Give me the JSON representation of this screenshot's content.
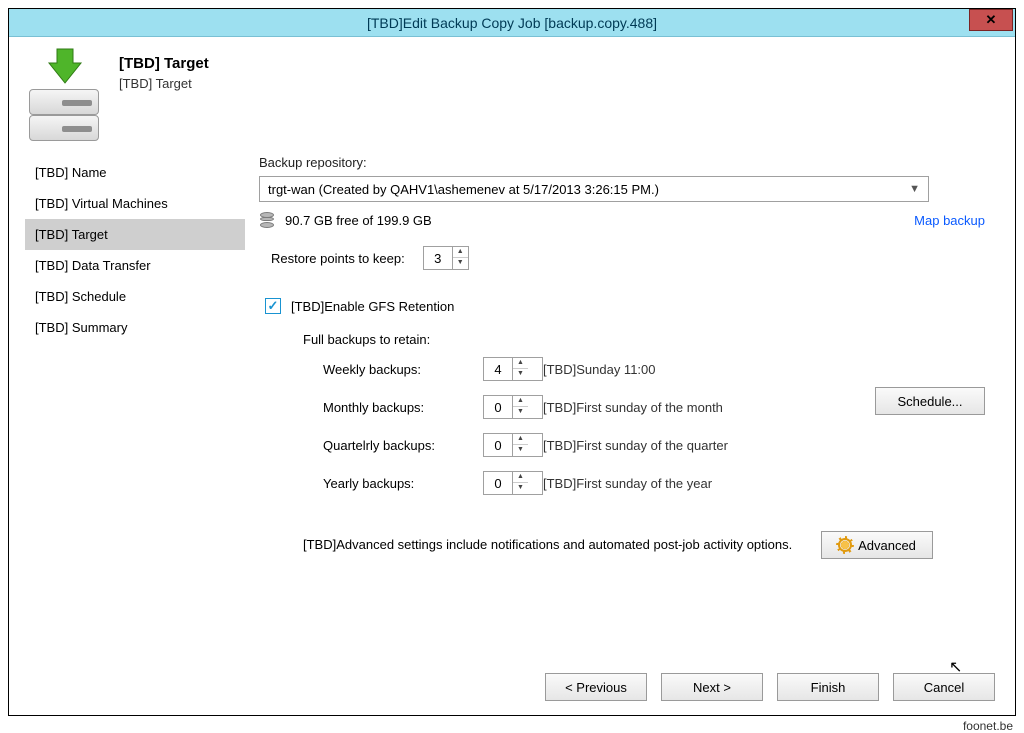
{
  "window": {
    "title": "[TBD]Edit Backup Copy Job [backup.copy.488]"
  },
  "header": {
    "title": "[TBD] Target",
    "subtitle": "[TBD] Target"
  },
  "sidebar": {
    "items": [
      {
        "label": "[TBD] Name"
      },
      {
        "label": "[TBD] Virtual Machines"
      },
      {
        "label": "[TBD] Target"
      },
      {
        "label": "[TBD] Data Transfer"
      },
      {
        "label": "[TBD] Schedule"
      },
      {
        "label": "[TBD] Summary"
      }
    ]
  },
  "content": {
    "repo_label": "Backup repository:",
    "repo_value": "trgt-wan (Created by QAHV1\\ashemenev at 5/17/2013 3:26:15 PM.)",
    "free_text": "90.7 GB free of 199.9 GB",
    "map_backup": "Map backup",
    "restore_label": "Restore points to keep:",
    "restore_value": "3",
    "gfs_label": "[TBD]Enable GFS Retention",
    "retain_title": "Full backups to retain:",
    "rows": {
      "weekly": {
        "label": "Weekly backups:",
        "value": "4",
        "desc": "[TBD]Sunday 11:00"
      },
      "monthly": {
        "label": "Monthly backups:",
        "value": "0",
        "desc": "[TBD]First sunday of the month"
      },
      "quarterly": {
        "label": "Quartelrly backups:",
        "value": "0",
        "desc": "[TBD]First sunday of the quarter"
      },
      "yearly": {
        "label": "Yearly backups:",
        "value": "0",
        "desc": "[TBD]First sunday of the year"
      }
    },
    "schedule_btn": "Schedule...",
    "advanced_text": "[TBD]Advanced settings include notifications and automated post-job activity options.",
    "advanced_btn": "Advanced"
  },
  "nav": {
    "previous": "< Previous",
    "next": "Next >",
    "finish": "Finish",
    "cancel": "Cancel"
  },
  "watermark": "foonet.be"
}
